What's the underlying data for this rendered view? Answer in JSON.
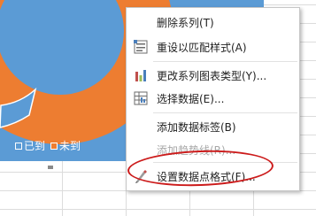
{
  "legend": {
    "items": [
      {
        "label": "已到",
        "color": "#5b9bd5"
      },
      {
        "label": "未到",
        "color": "#ed7d31"
      }
    ]
  },
  "chart_data": {
    "type": "pie",
    "categories": [
      "已到",
      "未到"
    ],
    "colors": [
      "#5b9bd5",
      "#ed7d31"
    ]
  },
  "context_menu": {
    "items": [
      {
        "label": "删除系列(T)",
        "icon": "none",
        "enabled": true
      },
      {
        "label": "重设以匹配样式(A)",
        "icon": "reset-style-icon",
        "enabled": true
      },
      {
        "label": "更改系列图表类型(Y)...",
        "icon": "chart-type-icon",
        "enabled": true
      },
      {
        "label": "选择数据(E)...",
        "icon": "select-data-icon",
        "enabled": true
      },
      {
        "label": "添加数据标签(B)",
        "icon": "none",
        "enabled": true
      },
      {
        "label": "添加趋势线(R)...",
        "icon": "none",
        "enabled": false
      },
      {
        "label": "设置数据点格式(F)...",
        "icon": "format-data-point-icon",
        "enabled": true
      }
    ]
  },
  "colors": {
    "chart_background": "#5b9bd5",
    "series_orange": "#ed7d31",
    "highlight_circle": "#cc1b1b"
  }
}
